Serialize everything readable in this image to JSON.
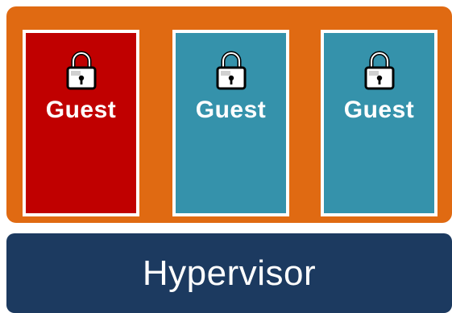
{
  "diagram": {
    "guests": [
      {
        "label": "Guest",
        "icon": "padlock-icon",
        "color": "#c00000"
      },
      {
        "label": "Guest",
        "icon": "padlock-icon",
        "color": "#3592ab"
      },
      {
        "label": "Guest",
        "icon": "padlock-icon",
        "color": "#3592ab"
      }
    ],
    "hypervisor": {
      "label": "Hypervisor",
      "color": "#1c3a60"
    },
    "host_color": "#e06a12"
  }
}
